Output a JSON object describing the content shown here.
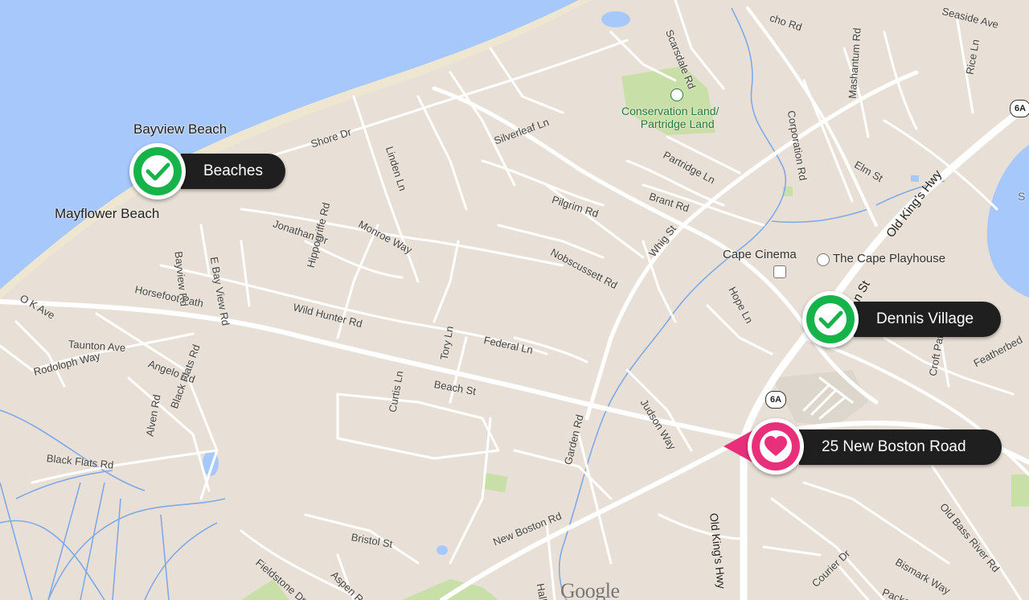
{
  "map": {
    "colors": {
      "water": "#a6c8fa",
      "land": "#e8e0d6",
      "road": "#ffffff",
      "park": "#c8dfa8",
      "check": "#16b34a",
      "heart": "#e8307a",
      "pill": "#1f1f1f"
    },
    "markers": {
      "beaches": {
        "label": "Beaches",
        "icon": "checkmark-icon"
      },
      "dennis_village": {
        "label": "Dennis Village",
        "icon": "checkmark-icon"
      },
      "home": {
        "label": "25 New Boston Road",
        "icon": "heart-icon"
      }
    },
    "places": {
      "bayview_beach": "Bayview Beach",
      "mayflower_beach": "Mayflower Beach",
      "conservation": "Conservation Land/",
      "partridge_land": "Partridge Land",
      "cape_cinema": "Cape Cinema",
      "cape_playhouse": "The Cape Playhouse"
    },
    "streets": {
      "shore_dr": "Shore Dr",
      "linden_ln": "Linden Ln",
      "silverleaf_ln": "Silverleaf Ln",
      "scarsdale_rd": "Scarsdale Rd",
      "cho_rd": "cho Rd",
      "seaside_ave": "Seaside Ave",
      "corporation_rd": "Corporation Rd",
      "mashantum_rd": "Mashantum Rd",
      "rice_ln": "Rice Ln",
      "elm_st": "Elm St",
      "partridge_ln": "Partridge Ln",
      "brant_rd": "Brant Rd",
      "pilgrim_rd": "Pilgrim Rd",
      "nobscussett_rd": "Nobscussett Rd",
      "whig_st": "Whig St",
      "old_kings_hwy_ne": "Old King's Hwy",
      "hope_ln": "Hope Ln",
      "n_st": "n St",
      "jonathan_dr": "Jonathan Dr",
      "monroe_way": "Monroe Way",
      "hippogriffe_rd": "Hippogriffe Rd",
      "bayview_rd": "Bayview Rd",
      "e_bay_view_rd": "E Bay View Rd",
      "ok_ave": "O K Ave",
      "horsefoot_path": "Horsefoot Path",
      "wild_hunter_rd": "Wild Hunter Rd",
      "federal_ln": "Federal Ln",
      "tory_ln": "Tory Ln",
      "taunton_ave": "Taunton Ave",
      "rodoloph_way": "Rodoloph Way",
      "angelo_rd": "Angelo Rd",
      "black_flats_rd_v": "Black Flats Rd",
      "beach_st": "Beach St",
      "curtis_ln": "Curtis Ln",
      "judson_way": "Judson Way",
      "croft_path": "Croft Path",
      "featherbed": "Featherbed",
      "alven_rd": "Alven Rd",
      "black_flats_rd": "Black Flats Rd",
      "garden_rd": "Garden Rd",
      "old_kings_hwy_s": "Old King's Hwy",
      "old_bass_river_rd": "Old Bass River Rd",
      "bristol_st": "Bristol St",
      "new_boston_rd": "New Boston Rd",
      "fieldstone_dr": "Fieldstone Dr",
      "aspen_rd": "Aspen Rd",
      "hall_st": "Hall St",
      "courier_dr": "Courier Dr",
      "bismark_way": "Bismark Way",
      "packet": "Packe"
    },
    "shields": {
      "top_right": "6A",
      "center": "6A"
    },
    "edge_letter": "S",
    "attribution": "Google"
  }
}
